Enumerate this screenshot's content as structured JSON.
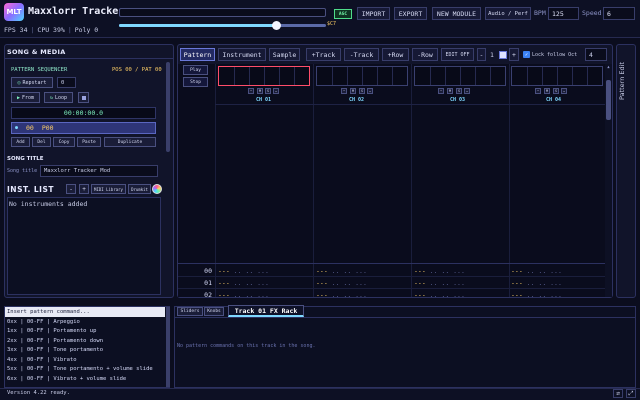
{
  "app": {
    "logo_text": "MLT",
    "title": "Maxxlorr Tracker",
    "stats": {
      "fps": "FPS 34",
      "cpu": "CPU 39%",
      "poly": "Poly 0"
    },
    "master_volume": {
      "value": 0.76,
      "label": "$C7"
    }
  },
  "toolbar": {
    "agc": "AGC",
    "import": "IMPORT",
    "export": "EXPORT",
    "new_module": "NEW MODULE",
    "audio_perf": "Audio / Perf",
    "bpm_label": "BPM",
    "bpm_value": "125",
    "speed_label": "Speed",
    "speed_value": "6"
  },
  "left": {
    "section_title": "SONG & MEDIA",
    "seq_label": "PATTERN SEQUENCER",
    "pos_label": "POS 00 / PAT 00",
    "repstart_label": "Repstart",
    "repstart_value": "0",
    "from_label": "From",
    "loop_label": "Loop",
    "time": "00:00:00.0",
    "order": {
      "index": "00",
      "pattern": "P00"
    },
    "order_buttons": [
      "Add",
      "Del",
      "Copy",
      "Paste",
      "Duplicate"
    ],
    "song_title_heading": "SONG TITLE",
    "song_field_label": "Song title",
    "song_title_value": "Maxxlorr Tracker Mod",
    "inst_title": "INST. LIST",
    "inst_minus": "-",
    "inst_plus": "+",
    "midi_library": "MIDI Library",
    "drumkit": "Drumkit",
    "inst_empty": "No instruments added"
  },
  "main": {
    "tabs": [
      "Pattern",
      "Instrument",
      "Sample"
    ],
    "track_buttons": [
      "+Track",
      "-Track",
      "+Row",
      "-Row"
    ],
    "edit_off": "EDIT OFF",
    "step_minus": "-",
    "step_value": "1",
    "step_plus": "+",
    "lock_follow": "Lock follow Oct",
    "oct_value": "4",
    "play": "Play",
    "stop": "Stop",
    "channels": [
      "CH 01",
      "CH 02",
      "CH 03",
      "CH 04"
    ],
    "channel_controls": [
      "−",
      "M",
      "S",
      "…"
    ],
    "rows": [
      "00",
      "01",
      "02"
    ],
    "cell_note": "---",
    "cell_rest": " .. .. ..."
  },
  "rail": {
    "label": "Pattern Edit"
  },
  "commands": {
    "placeholder": "Insert pattern command...",
    "items": [
      "0xx | 00-FF | Arpeggio",
      "1xx | 00-FF | Portamento up",
      "2xx | 00-FF | Portamento down",
      "3xx | 00-FF | Tone portamento",
      "4xx | 00-FF | Vibrato",
      "5xx | 00-FF | Tone portamento + volume slide",
      "6xx | 00-FF | Vibrato + volume slide"
    ]
  },
  "fx": {
    "sliders": "Sliders",
    "knobs": "Knobs",
    "tab": "Track 01 FX Rack",
    "empty": "No pattern commands on this track in the song."
  },
  "status": {
    "text": "Version 4.22 ready."
  }
}
